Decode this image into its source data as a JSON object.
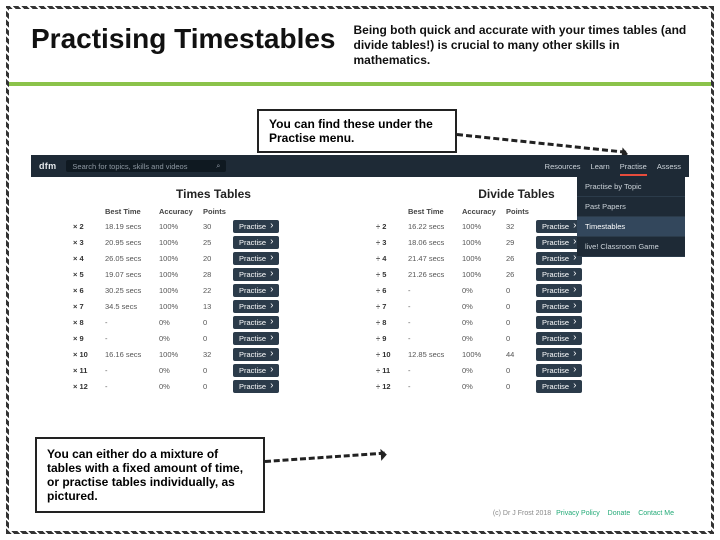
{
  "title": "Practising Timestables",
  "intro": "Being both quick and accurate with your times tables (and divide tables!) is crucial to many other skills in mathematics.",
  "callout_top": "You can find these under the Practise menu.",
  "callout_bottom": "You can either do a mixture of tables with a fixed amount of time, or practise tables individually, as pictured.",
  "nav": {
    "logo": "dfm",
    "search_placeholder": "Search for topics, skills and videos",
    "search_icon": "⌕",
    "items": [
      "Resources",
      "Learn",
      "Practise",
      "Assess"
    ],
    "active": "Practise"
  },
  "dropdown": {
    "items": [
      "Practise by Topic",
      "Past Papers",
      "Timestables",
      "live! Classroom Game"
    ],
    "active": "Timestables"
  },
  "times": {
    "title": "Times Tables",
    "headers": [
      "",
      "Best Time",
      "Accuracy",
      "Points",
      ""
    ],
    "rows": [
      {
        "label": "× 2",
        "best": "18.19 secs",
        "acc": "100%",
        "pts": "30"
      },
      {
        "label": "× 3",
        "best": "20.95 secs",
        "acc": "100%",
        "pts": "25"
      },
      {
        "label": "× 4",
        "best": "26.05 secs",
        "acc": "100%",
        "pts": "20"
      },
      {
        "label": "× 5",
        "best": "19.07 secs",
        "acc": "100%",
        "pts": "28"
      },
      {
        "label": "× 6",
        "best": "30.25 secs",
        "acc": "100%",
        "pts": "22"
      },
      {
        "label": "× 7",
        "best": "34.5 secs",
        "acc": "100%",
        "pts": "13"
      },
      {
        "label": "× 8",
        "best": "-",
        "acc": "0%",
        "pts": "0"
      },
      {
        "label": "× 9",
        "best": "-",
        "acc": "0%",
        "pts": "0"
      },
      {
        "label": "× 10",
        "best": "16.16 secs",
        "acc": "100%",
        "pts": "32"
      },
      {
        "label": "× 11",
        "best": "-",
        "acc": "0%",
        "pts": "0"
      },
      {
        "label": "× 12",
        "best": "-",
        "acc": "0%",
        "pts": "0"
      }
    ],
    "btn": "Practise"
  },
  "divide": {
    "title": "Divide Tables",
    "headers": [
      "",
      "Best Time",
      "Accuracy",
      "Points",
      ""
    ],
    "rows": [
      {
        "label": "÷ 2",
        "best": "16.22 secs",
        "acc": "100%",
        "pts": "32"
      },
      {
        "label": "÷ 3",
        "best": "18.06 secs",
        "acc": "100%",
        "pts": "29"
      },
      {
        "label": "÷ 4",
        "best": "21.47 secs",
        "acc": "100%",
        "pts": "26"
      },
      {
        "label": "÷ 5",
        "best": "21.26 secs",
        "acc": "100%",
        "pts": "26"
      },
      {
        "label": "÷ 6",
        "best": "-",
        "acc": "0%",
        "pts": "0"
      },
      {
        "label": "÷ 7",
        "best": "-",
        "acc": "0%",
        "pts": "0"
      },
      {
        "label": "÷ 8",
        "best": "-",
        "acc": "0%",
        "pts": "0"
      },
      {
        "label": "÷ 9",
        "best": "-",
        "acc": "0%",
        "pts": "0"
      },
      {
        "label": "÷ 10",
        "best": "12.85 secs",
        "acc": "100%",
        "pts": "44"
      },
      {
        "label": "÷ 11",
        "best": "-",
        "acc": "0%",
        "pts": "0"
      },
      {
        "label": "÷ 12",
        "best": "-",
        "acc": "0%",
        "pts": "0"
      }
    ],
    "btn": "Practise"
  },
  "footer": {
    "copyright": "(c) Dr J Frost 2018",
    "links": [
      "Privacy Policy",
      "Donate",
      "Contact Me"
    ]
  }
}
